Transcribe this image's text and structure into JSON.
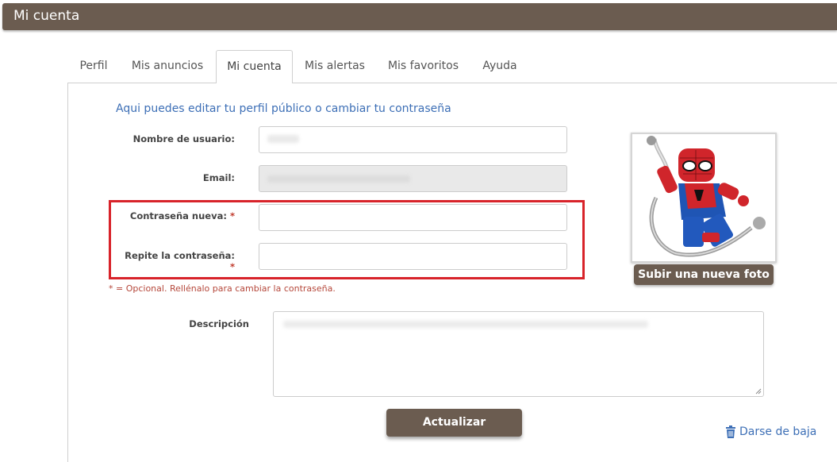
{
  "header": {
    "title": "Mi cuenta"
  },
  "tabs": [
    {
      "label": "Perfil",
      "active": false
    },
    {
      "label": "Mis anuncios",
      "active": false
    },
    {
      "label": "Mi cuenta",
      "active": true
    },
    {
      "label": "Mis alertas",
      "active": false
    },
    {
      "label": "Mis favoritos",
      "active": false
    },
    {
      "label": "Ayuda",
      "active": false
    }
  ],
  "form": {
    "intro": "Aqui puedes editar tu perfil público o cambiar tu contraseña",
    "username_label": "Nombre de usuario:",
    "email_label": "Email:",
    "new_password_label": "Contraseña nueva:",
    "repeat_password_label": "Repite la contraseña:",
    "required_mark": "*",
    "note": "* = Opcional. Rellénalo para cambiar la contraseña.",
    "description_label": "Descripción",
    "update_button": "Actualizar"
  },
  "photo": {
    "upload_button": "Subir una nueva foto",
    "alt": "lego-spiderman-avatar"
  },
  "unsubscribe": {
    "label": "Darse de baja",
    "icon": "trash-icon"
  },
  "colors": {
    "brand": "#6b5c50",
    "link": "#3d6fb6",
    "highlight": "#d8232a",
    "note": "#b5473a"
  }
}
